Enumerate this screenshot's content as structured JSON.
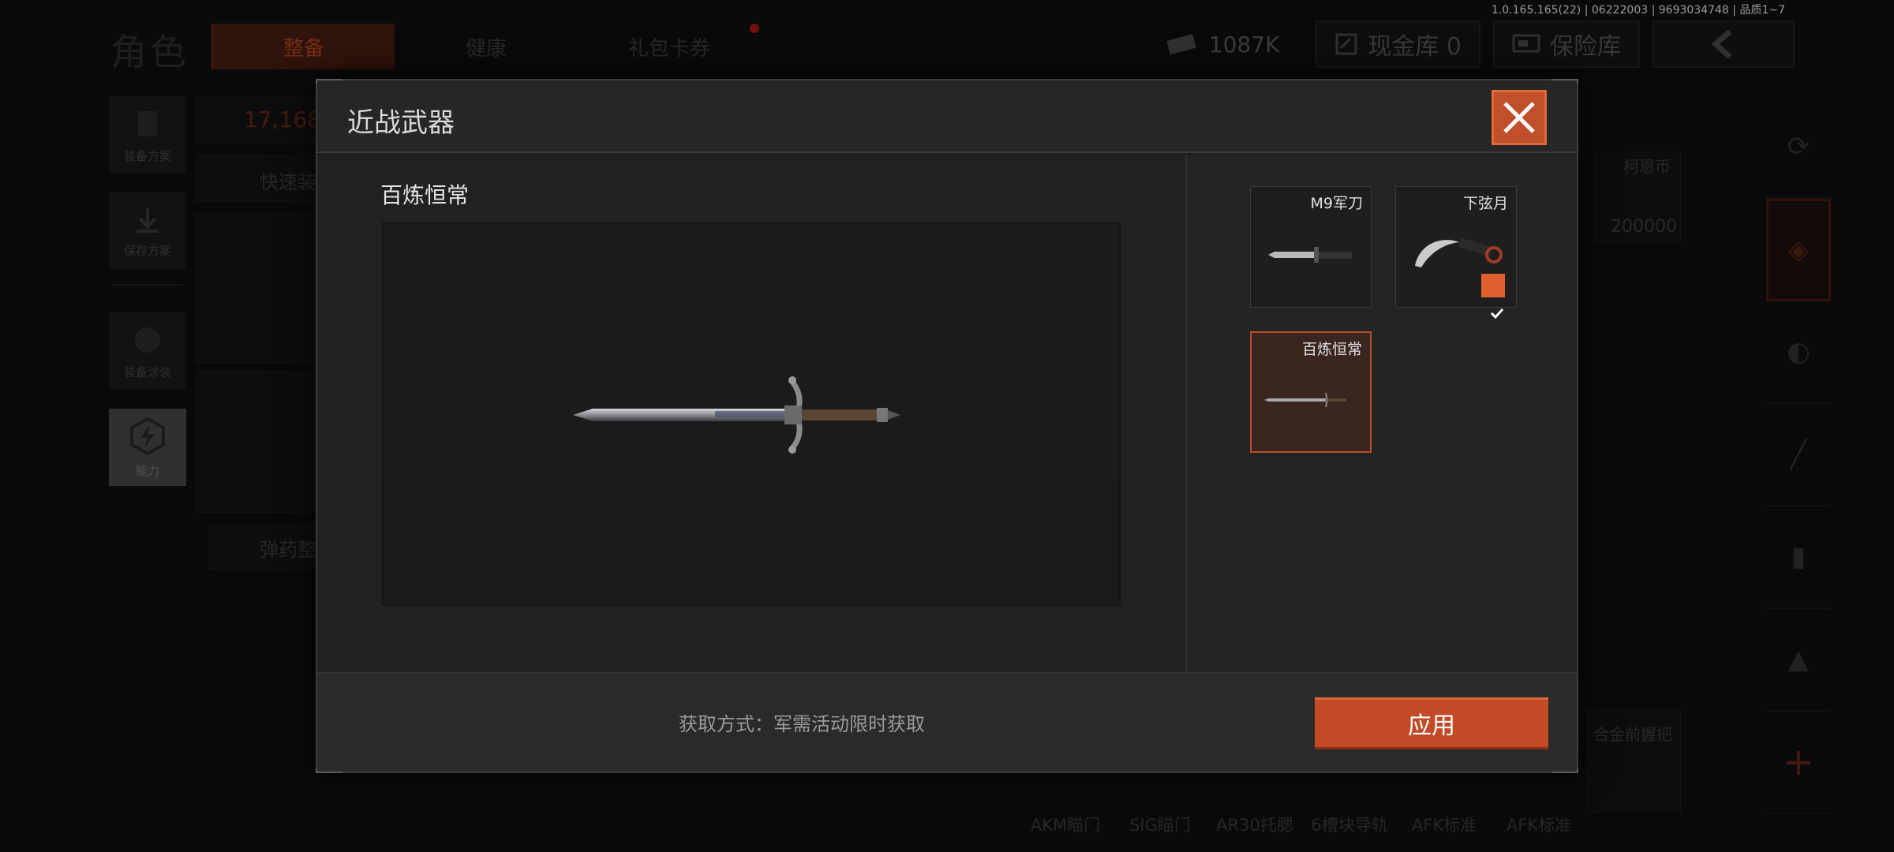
{
  "version_info": "1.0.165.165(22) | 06222003 | 9693034748 | 品质1~7",
  "background": {
    "page_title": "角色",
    "tabs": [
      {
        "label": "整备",
        "active": true
      },
      {
        "label": "健康",
        "active": false
      },
      {
        "label": "礼包卡券",
        "active": false
      }
    ],
    "currency_value": "1087K",
    "cash_vault_label": "现金库 0",
    "insurance_label": "保险库",
    "side_buttons": [
      {
        "label": "装备方案",
        "icon": "vest-icon"
      },
      {
        "label": "保存方案",
        "icon": "download-icon"
      },
      {
        "label": "装备涂装",
        "icon": "helmet-icon"
      },
      {
        "label": "能力",
        "icon": "lightning-icon"
      }
    ],
    "value_display": "17,168",
    "quick_equip_label": "快速装",
    "ammo_label": "弹药整",
    "coin_label": "柯恩币",
    "coin_value": "200000",
    "grip_label": "合金前握把",
    "bottom_items": [
      "AKM瞄门",
      "SIG瞄门",
      "AR30托腮",
      "6槽块导轨",
      "AFK标准",
      "AFK标准"
    ]
  },
  "modal": {
    "title": "近战武器",
    "selected_weapon_name": "百炼恒常",
    "weapons": [
      {
        "label": "M9军刀",
        "selected": false,
        "equipped": false,
        "icon": "m9-bayonet-icon"
      },
      {
        "label": "下弦月",
        "selected": false,
        "equipped": true,
        "icon": "karambit-icon"
      },
      {
        "label": "百炼恒常",
        "selected": true,
        "equipped": false,
        "icon": "longsword-icon"
      }
    ],
    "acquire_text": "获取方式：军需活动限时获取",
    "apply_label": "应用"
  },
  "colors": {
    "accent": "#c24a24",
    "accent_light": "#e0602f",
    "panel": "#202021"
  }
}
